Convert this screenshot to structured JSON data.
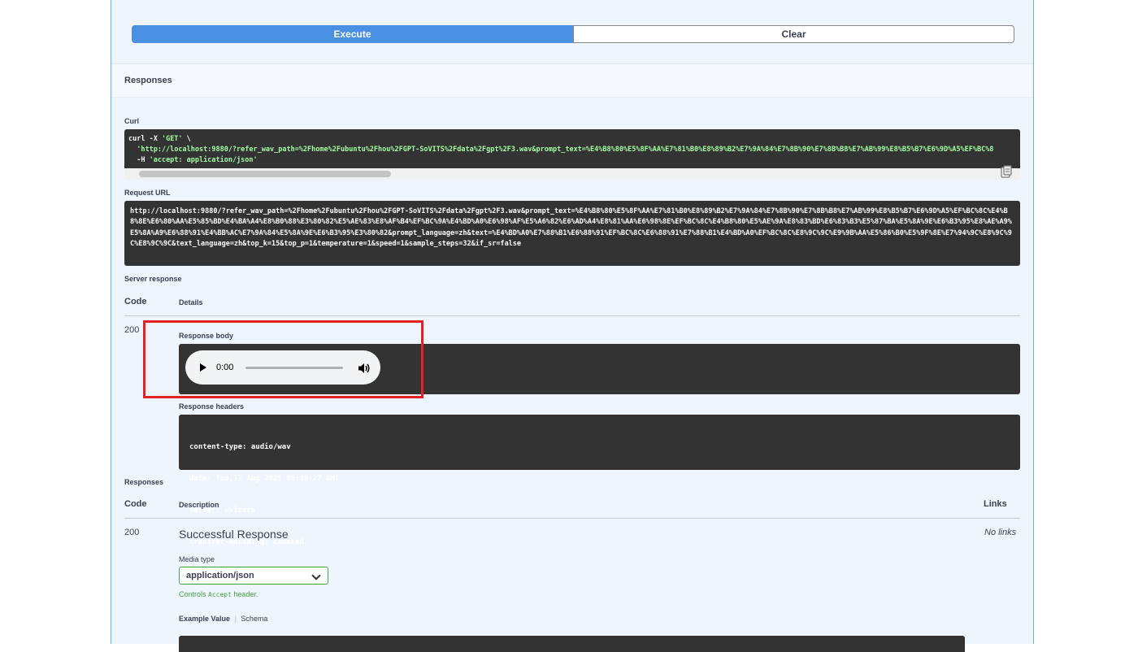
{
  "actions": {
    "execute_label": "Execute",
    "clear_label": "Clear"
  },
  "responses_section": {
    "title": "Responses"
  },
  "curl": {
    "label": "Curl",
    "line1_cmd": "curl -X ",
    "line1_method": "'GET'",
    "line1_tail": " \\",
    "line2": "  'http://localhost:9880/?refer_wav_path=%2Fhome%2Fubuntu%2Fhou%2FGPT-SoVITS%2Fdata%2Fgpt%2F3.wav&prompt_text=%E4%B8%80%E5%8F%AA%E7%81%B0%E8%89%B2%E7%9A%84%E7%8B%90%E7%8B%B8%E7%AB%99%E8%B5%B7%E6%9D%A5%EF%BC%8",
    "line3_prefix": "  -H ",
    "line3_value": "'accept: application/json'"
  },
  "request_url": {
    "label": "Request URL",
    "value": "http://localhost:9880/?refer_wav_path=%2Fhome%2Fubuntu%2Fhou%2FGPT-SoVITS%2Fdata%2Fgpt%2F3.wav&prompt_text=%E4%B8%80%E5%8F%AA%E7%81%B0%E8%89%B2%E7%9A%84%E7%8B%90%E7%8B%B8%E7%AB%99%E8%B5%B7%E6%9D%A5%EF%BC%8C%E4%B8%8E%E6%80%AA%E5%85%BD%E4%BA%A4%E8%B0%88%E3%80%82%E5%AE%83%E8%AF%B4%EF%BC%9A%E4%BD%A0%E6%98%AF%E5%A6%82%E6%AD%A4%E8%81%AA%E6%98%8E%EF%BC%8C%E4%B8%80%E5%AE%9A%E8%83%BD%E6%83%B3%E5%87%BA%E5%8A%9E%E6%B3%95%E8%AE%A9%E5%8A%A9%E6%88%91%E4%BB%AC%E7%9A%84%E5%8A%9E%E6%B3%95%E3%80%82&prompt_language=zh&text=%E4%BD%A0%E7%88%B1%E6%88%91%EF%BC%8C%E6%88%91%E7%88%B1%E4%BD%A0%EF%BC%8C%E8%9C%9C%E9%9B%AA%E5%86%B0%E5%9F%8E%E7%94%9C%E8%9C%9C%E8%9C%9C&text_language=zh&top_k=15&top_p=1&temperature=1&speed=1&sample_steps=32&if_sr=false"
  },
  "server_response": {
    "label": "Server response",
    "col_code": "Code",
    "col_details": "Details",
    "code": "200",
    "body_label": "Response body",
    "audio_time": "0:00",
    "headers_label": "Response headers",
    "headers": [
      "content-type: audio/wav",
      "date: Tue,12 Aug 2025 06:49:27 GMT",
      "server: uvicorn",
      "transfer-encoding: chunked"
    ]
  },
  "documented_responses": {
    "label": "Responses",
    "col_code": "Code",
    "col_description": "Description",
    "col_links": "Links",
    "code": "200",
    "description": "Successful Response",
    "links": "No links",
    "media_type_label": "Media type",
    "media_type_value": "application/json",
    "controls_pre": "Controls ",
    "controls_code": "Accept",
    "controls_post": " header.",
    "example_value_tab": "Example Value",
    "schema_tab": "Schema"
  }
}
